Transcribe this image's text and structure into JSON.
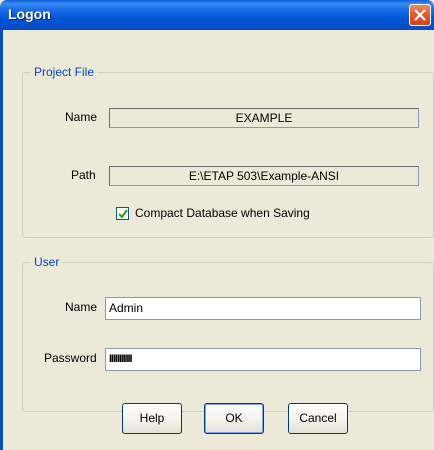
{
  "window": {
    "title": "Logon"
  },
  "project_file": {
    "legend": "Project File",
    "name_label": "Name",
    "name_value": "EXAMPLE",
    "path_label": "Path",
    "path_value": "E:\\ETAP 503\\Example-ANSI",
    "compact_label": "Compact Database when Saving",
    "compact_checked": true
  },
  "user": {
    "legend": "User",
    "name_label": "Name",
    "name_value": "Admin",
    "password_label": "Password",
    "password_masked": "IIIIIIIIIII"
  },
  "buttons": {
    "help": "Help",
    "ok": "OK",
    "cancel": "Cancel"
  },
  "colors": {
    "title_bar": "#0050cc",
    "group_legend": "#0046d5",
    "close_button": "#e45a2e"
  }
}
